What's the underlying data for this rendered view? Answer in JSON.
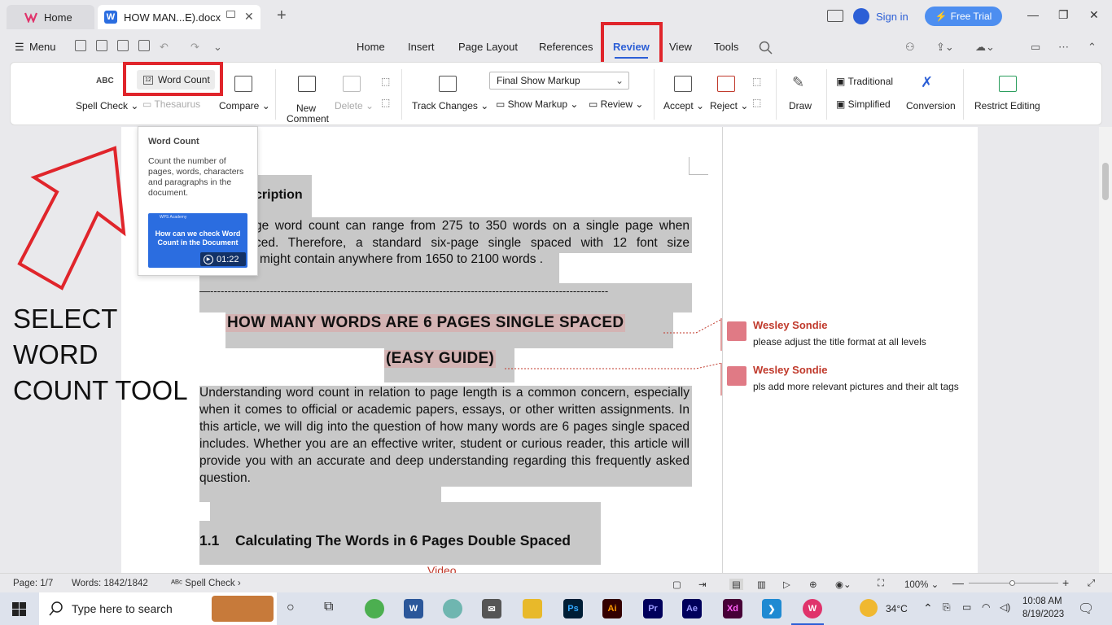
{
  "titlebar": {
    "home_tab": "Home",
    "doc_tab": "HOW MAN...E).docx",
    "sign_in": "Sign in",
    "free_trial": "Free Trial"
  },
  "menubar": {
    "menu": "Menu",
    "tabs": [
      "Home",
      "Insert",
      "Page Layout",
      "References",
      "Review",
      "View",
      "Tools"
    ],
    "active_tab": "Review"
  },
  "ribbon": {
    "spell_check": "Spell Check",
    "word_count": "Word Count",
    "thesaurus": "Thesaurus",
    "compare": "Compare",
    "new_comment_line1": "New",
    "new_comment_line2": "Comment",
    "delete": "Delete",
    "track_changes": "Track Changes",
    "markup_dropdown": "Final Show Markup",
    "show_markup": "Show Markup",
    "review": "Review",
    "accept": "Accept",
    "reject": "Reject",
    "draw": "Draw",
    "traditional": "Traditional",
    "simplified": "Simplified",
    "conversion": "Conversion",
    "restrict_editing": "Restrict Editing"
  },
  "tooltip": {
    "title": "Word Count",
    "description": "Count the number of pages, words, characters and paragraphs in the document.",
    "video_brand": "WPS Academy",
    "video_title": "How can we check Word Count in the Document",
    "video_duration": "01:22"
  },
  "annotation": {
    "line1": "SELECT WORD",
    "line2": "COUNT TOOL"
  },
  "document": {
    "section_heading_partial": "cription",
    "para1_line1": "ge word count can range from 275 to 350 words on a single page when",
    "para1_line2": "ced. Therefore, a standard six-page single spaced with 12 font size",
    "para1_line3": "might contain anywhere from 1650 to 2100 words .",
    "divider": "—-----------------------------------------------------------------------------------------------------------------",
    "title_line1": "HOW MANY WORDS ARE 6 PAGES SINGLE SPACED",
    "title_line2": "(EASY GUIDE)",
    "body_paragraph": "Understanding word count in relation to page length is a common concern, especially when it comes to official or academic papers, essays, or other written assignments. In this article, we will dig into the question of how many words are 6 pages single spaced includes. Whether you are an effective writer, student or curious reader, this article will provide you with an accurate and deep understanding regarding this frequently asked question.",
    "subheading_number": "1.1",
    "subheading": "Calculating The Words in 6 Pages Double Spaced",
    "video_link": "Video"
  },
  "comments": [
    {
      "author": "Wesley Sondie",
      "text": "please adjust the title format at all levels"
    },
    {
      "author": "Wesley Sondie",
      "text": "pls add more relevant pictures and their alt tags"
    }
  ],
  "statusbar": {
    "page": "Page: 1/7",
    "words": "Words: 1842/1842",
    "spell_check": "Spell Check",
    "zoom": "100%"
  },
  "taskbar": {
    "search_placeholder": "Type here to search",
    "temperature": "34°C",
    "time": "10:08 AM",
    "date": "8/19/2023",
    "apps": [
      "Ps",
      "Ai",
      "Pr",
      "Ae",
      "Xd"
    ]
  },
  "colors": {
    "accent": "#2c5fd6",
    "highlight_box": "#e0252b",
    "selection": "#c8c8c8",
    "comment_author": "#c0392b"
  }
}
